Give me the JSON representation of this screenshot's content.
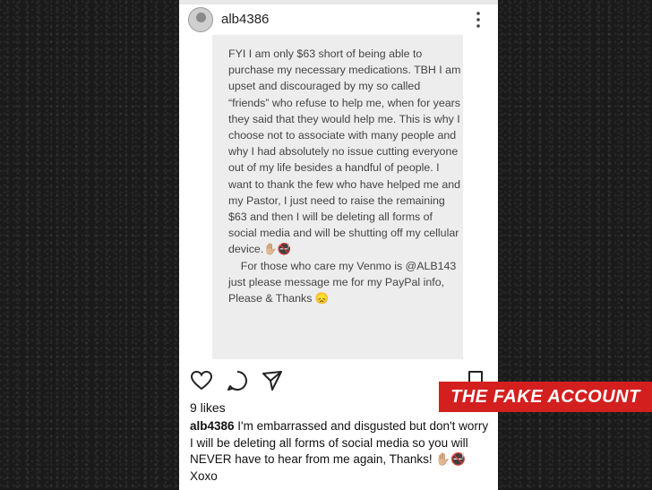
{
  "post": {
    "username": "alb4386",
    "note_text": "FYI I am only $63 short of being able to purchase my necessary medications. TBH I am upset and discouraged by my so called “friends” who refuse to help me, when for years they said that they would help me. This is why I choose not to associate with many people and why I had absolutely no issue cutting everyone out of my life besides a handful of people. I want to thank the few who have helped me and my Pastor, I just need to raise the remaining $63 and then I will be deleting all forms of social media and will be shutting off my cellular device.✋🏼🚭\n    For those who care my Venmo is @ALB143 just please message me for my PayPal info, Please & Thanks 😞",
    "likes": "9 likes",
    "caption_user": "alb4386",
    "caption_text": " I'm embarrassed and disgusted but don't worry I will be deleting all forms of social media so you will NEVER have to hear from me again, Thanks! ✋🏼🚭 Xoxo"
  },
  "overlay_label": "THE FAKE ACCOUNT",
  "colors": {
    "label_bg": "#d41f1f",
    "background": "#1a1a1a",
    "note_bg": "#ededed"
  },
  "icons": [
    "avatar",
    "more-icon",
    "heart-icon",
    "comment-icon",
    "share-icon",
    "bookmark-icon"
  ]
}
